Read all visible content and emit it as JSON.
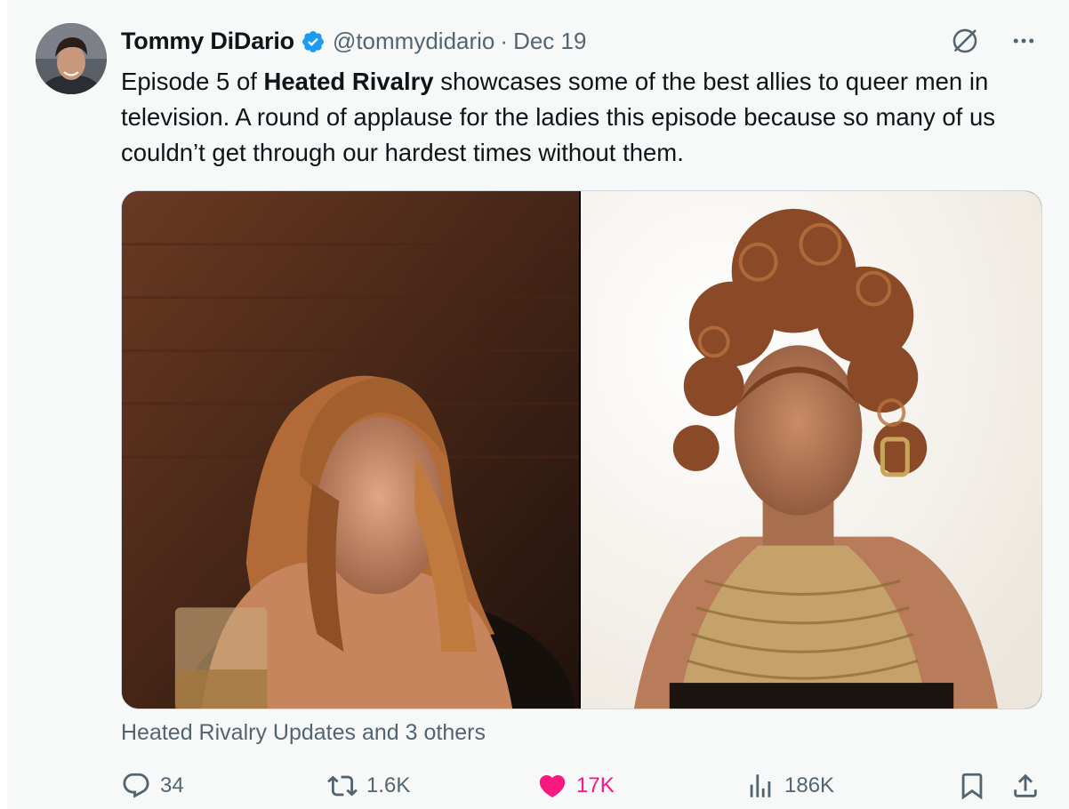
{
  "post": {
    "author_name": "Tommy DiDario",
    "author_handle": "@tommydidario",
    "separator": "·",
    "date": "Dec 19",
    "text_part1": "Episode 5 of ",
    "text_bold": "Heated Rivalry",
    "text_part2": " showcases some of the best allies to queer men in television. A round of applause for the ladies this episode because so many of us couldn’t get through our hardest times without them.",
    "tagged_users": "Heated Rivalry Updates and 3 others"
  },
  "icons": {
    "verified": "verified-badge-icon",
    "grok": "grok-icon",
    "more": "more-icon",
    "reply": "reply-icon",
    "retweet": "retweet-icon",
    "like": "like-icon",
    "views": "views-icon",
    "bookmark": "bookmark-icon",
    "share": "share-icon"
  },
  "stats": {
    "replies": "34",
    "reposts": "1.6K",
    "likes": "17K",
    "views": "186K"
  },
  "colors": {
    "verified_blue": "#1d9bf0",
    "like_pink": "#f91880",
    "secondary_text": "#536471",
    "background": "#f7f9f9"
  }
}
